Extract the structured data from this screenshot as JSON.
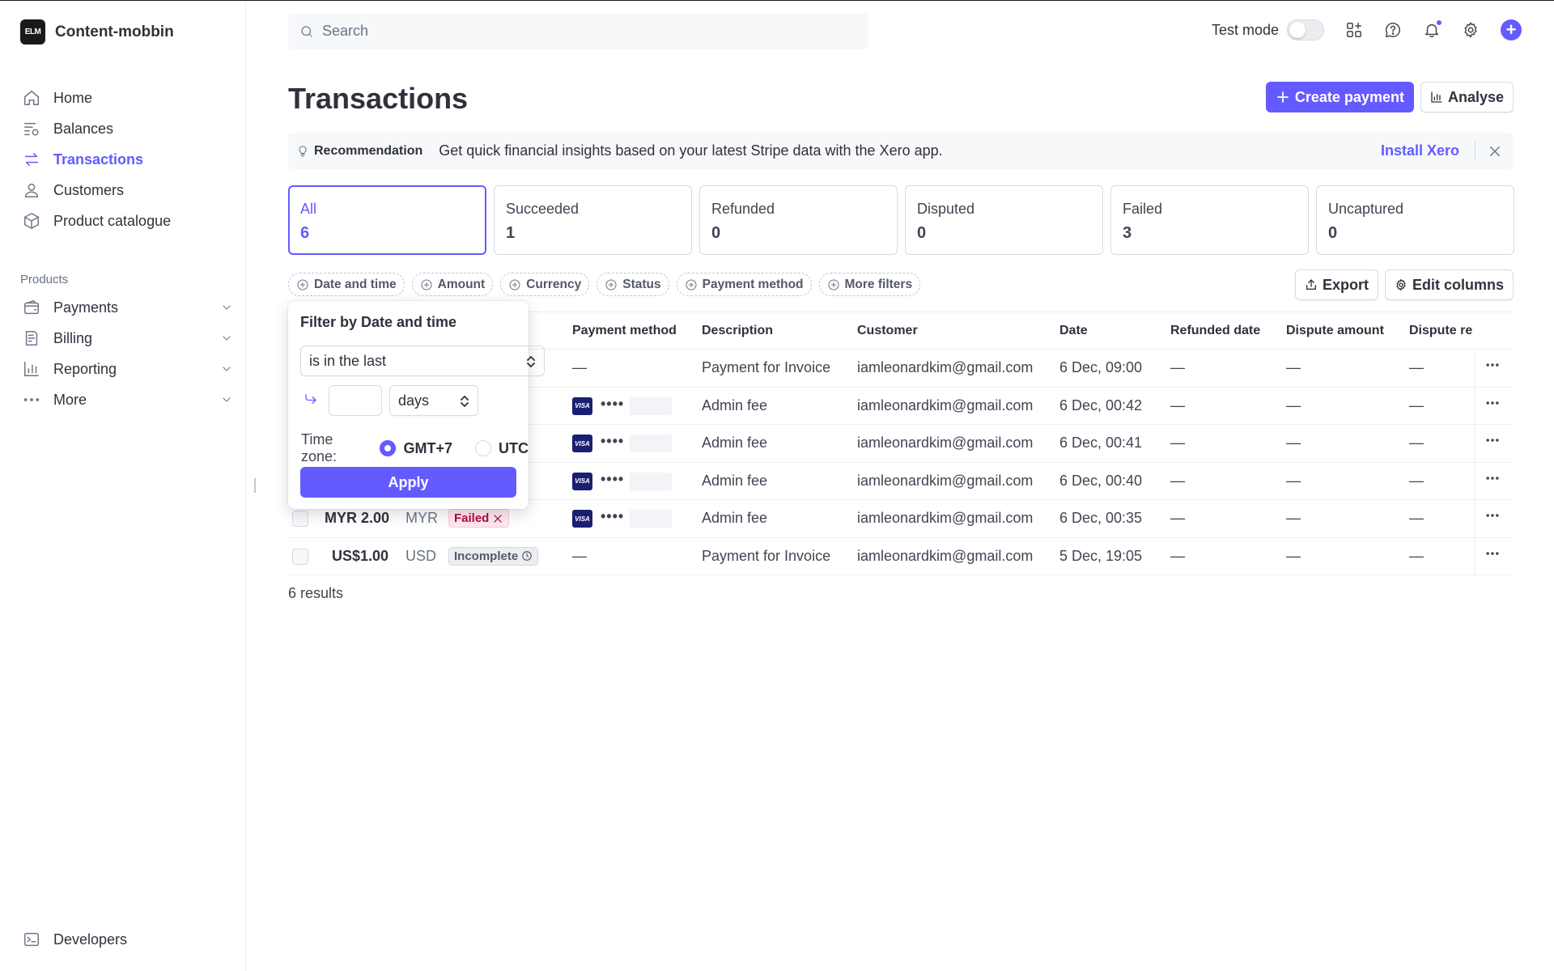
{
  "brand": {
    "name": "Content-mobbin",
    "logo_text": "ELM"
  },
  "nav": {
    "items": [
      {
        "label": "Home",
        "icon": "home-icon"
      },
      {
        "label": "Balances",
        "icon": "balances-icon"
      },
      {
        "label": "Transactions",
        "icon": "transactions-icon",
        "active": true
      },
      {
        "label": "Customers",
        "icon": "customer-icon"
      },
      {
        "label": "Product catalogue",
        "icon": "box-icon"
      }
    ],
    "section_label": "Products",
    "product_items": [
      {
        "label": "Payments",
        "icon": "payments-icon"
      },
      {
        "label": "Billing",
        "icon": "billing-icon"
      },
      {
        "label": "Reporting",
        "icon": "reporting-icon"
      },
      {
        "label": "More",
        "icon": "more-dots-icon"
      }
    ],
    "developers": "Developers"
  },
  "topbar": {
    "search_placeholder": "Search",
    "test_mode_label": "Test mode",
    "test_mode_on": false
  },
  "header": {
    "title": "Transactions",
    "create_payment": "Create payment",
    "analyse": "Analyse"
  },
  "recommendation": {
    "label": "Recommendation",
    "text": "Get quick financial insights based on your latest Stripe data with the Xero app.",
    "link": "Install Xero"
  },
  "status_cards": [
    {
      "label": "All",
      "count": "6",
      "active": true
    },
    {
      "label": "Succeeded",
      "count": "1"
    },
    {
      "label": "Refunded",
      "count": "0"
    },
    {
      "label": "Disputed",
      "count": "0"
    },
    {
      "label": "Failed",
      "count": "3"
    },
    {
      "label": "Uncaptured",
      "count": "0"
    }
  ],
  "filters": [
    "Date and time",
    "Amount",
    "Currency",
    "Status",
    "Payment method",
    "More filters"
  ],
  "table_actions": {
    "export": "Export",
    "edit_columns": "Edit columns"
  },
  "table": {
    "columns": [
      "Payment method",
      "Description",
      "Customer",
      "Date",
      "Refunded date",
      "Dispute amount",
      "Dispute re"
    ],
    "rows": [
      {
        "amount": "",
        "currency": "",
        "status": "",
        "pm": "—",
        "card": false,
        "description": "Payment for Invoice",
        "customer": "iamleonardkim@gmail.com",
        "date": "6 Dec, 09:00",
        "refunded": "—",
        "dispute_amount": "—",
        "dispute_reason": "—"
      },
      {
        "amount": "",
        "currency": "",
        "status": "",
        "pm": "••••",
        "card": true,
        "description": "Admin fee",
        "customer": "iamleonardkim@gmail.com",
        "date": "6 Dec, 00:42",
        "refunded": "—",
        "dispute_amount": "—",
        "dispute_reason": "—"
      },
      {
        "amount": "",
        "currency": "",
        "status": "",
        "pm": "••••",
        "card": true,
        "description": "Admin fee",
        "customer": "iamleonardkim@gmail.com",
        "date": "6 Dec, 00:41",
        "refunded": "—",
        "dispute_amount": "—",
        "dispute_reason": "—"
      },
      {
        "amount": "",
        "currency": "",
        "status": "",
        "pm": "••••",
        "card": true,
        "description": "Admin fee",
        "customer": "iamleonardkim@gmail.com",
        "date": "6 Dec, 00:40",
        "refunded": "—",
        "dispute_amount": "—",
        "dispute_reason": "—"
      },
      {
        "amount": "MYR 2.00",
        "currency": "MYR",
        "status": "Failed",
        "pm": "••••",
        "card": true,
        "description": "Admin fee",
        "customer": "iamleonardkim@gmail.com",
        "date": "6 Dec, 00:35",
        "refunded": "—",
        "dispute_amount": "—",
        "dispute_reason": "—"
      },
      {
        "amount": "US$1.00",
        "currency": "USD",
        "status": "Incomplete",
        "pm": "—",
        "card": false,
        "description": "Payment for Invoice",
        "customer": "iamleonardkim@gmail.com",
        "date": "5 Dec, 19:05",
        "refunded": "—",
        "dispute_amount": "—",
        "dispute_reason": "—"
      }
    ],
    "card_brand": "VISA",
    "results": "6 results"
  },
  "popover": {
    "title": "Filter by Date and time",
    "condition": "is in the last",
    "value": "",
    "unit": "days",
    "timezone_label": "Time zone:",
    "timezone_options": [
      "GMT+7",
      "UTC"
    ],
    "timezone_selected": "GMT+7",
    "apply": "Apply"
  },
  "colors": {
    "accent": "#635bff",
    "failed_text": "#b3093c",
    "failed_bg": "#ffe7f2",
    "visa_blue": "#1a1f71"
  }
}
